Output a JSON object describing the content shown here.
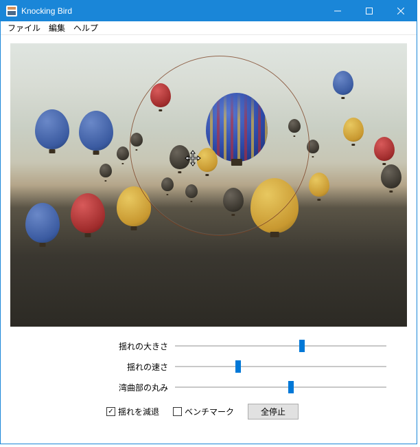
{
  "window": {
    "title": "Knocking Bird"
  },
  "menubar": {
    "items": [
      "ファイル",
      "編集",
      "ヘルプ"
    ]
  },
  "sliders": [
    {
      "label": "揺れの大きさ",
      "value": 60
    },
    {
      "label": "揺れの速さ",
      "value": 30
    },
    {
      "label": "湾曲部の丸み",
      "value": 55
    }
  ],
  "checkboxes": {
    "reduce_shake": {
      "label": "揺れを減退",
      "checked": true
    },
    "benchmark": {
      "label": "ベンチマーク",
      "checked": false
    }
  },
  "buttons": {
    "stop_all": "全停止"
  }
}
